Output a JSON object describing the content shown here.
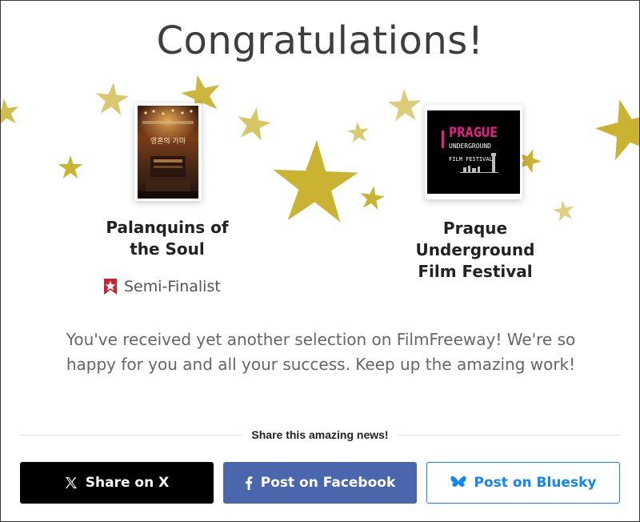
{
  "modal": {
    "title": "Congratulations!",
    "film": {
      "title_line1": "Palanquins of",
      "title_line2": "the Soul",
      "poster_text": "영혼의 가마"
    },
    "festival": {
      "line1": "Praque",
      "line2": "Underground",
      "line3": "Film Festival",
      "logo_line1": "PRAGUE",
      "logo_line2": "UNDERGROUND",
      "logo_line3": "FILM FESTIVAL"
    },
    "status": {
      "label": "Semi-Finalist",
      "icon": "ribbon-star-icon",
      "color": "#c6262e"
    },
    "message": "You've received yet another selection on FilmFreeway! We're so happy for you and all your success. Keep up the amazing work!",
    "share_label": "Share this amazing news!",
    "buttons": {
      "x": {
        "label": "Share on X",
        "icon": "x-logo-icon",
        "bg": "#000000"
      },
      "facebook": {
        "label": "Post on Facebook",
        "icon": "facebook-icon",
        "bg": "#4a67ad"
      },
      "bluesky": {
        "label": "Post on Bluesky",
        "icon": "butterfly-icon",
        "color": "#1185fe"
      }
    },
    "star_color": "#c9b331"
  }
}
